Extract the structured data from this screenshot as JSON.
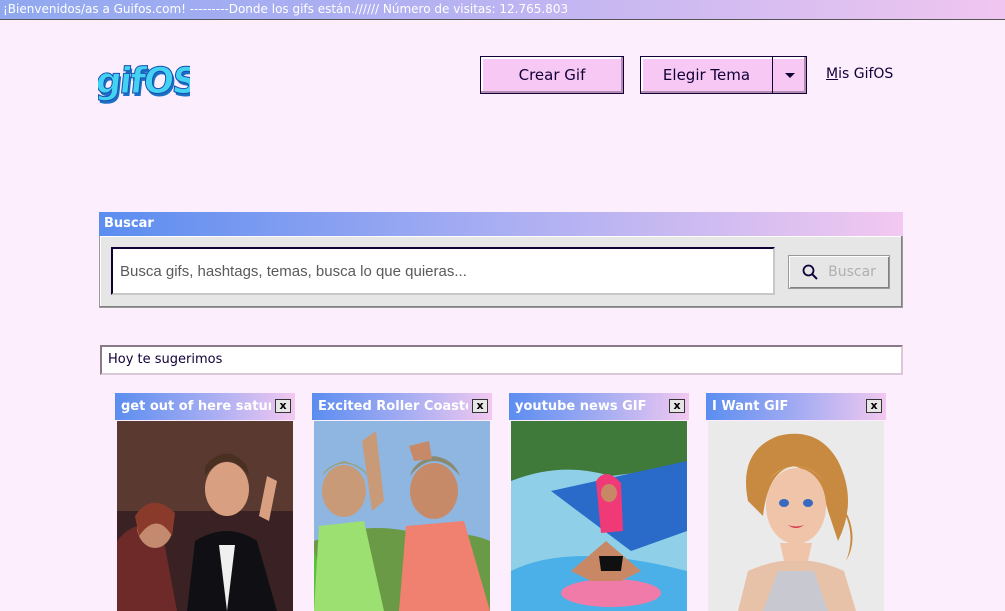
{
  "ticker": "¡Bienvenidos/as a Guifos.com! ---------Donde los gifs están.////// Número de visitas: 12.765.803",
  "header": {
    "logo_text": "gifOS",
    "crear_gif": "Crear Gif",
    "elegir_tema": "Elegir Tema",
    "mis_gifos_first": "M",
    "mis_gifos_rest": "is GifOS"
  },
  "search": {
    "title": "Buscar",
    "placeholder": "Busca gifs, hashtags, temas, busca lo que quieras...",
    "button": "Buscar"
  },
  "suggestions": {
    "title": "Hoy te sugerimos",
    "cards": [
      {
        "title": "get out of here saturday",
        "close": "x",
        "image": "man-in-suit-pointing"
      },
      {
        "title": "Excited Roller Coaster",
        "close": "x",
        "image": "elderly-women-cheering"
      },
      {
        "title": "youtube news GIF",
        "close": "x",
        "image": "water-slide"
      },
      {
        "title": "I Want GIF",
        "close": "x",
        "image": "barbie-doll"
      }
    ]
  },
  "colors": {
    "background": "#fdeefd",
    "button": "#f7c8f3",
    "text": "#110038",
    "gradient_start": "#5b8df0",
    "gradient_end": "#f2c8f0"
  }
}
